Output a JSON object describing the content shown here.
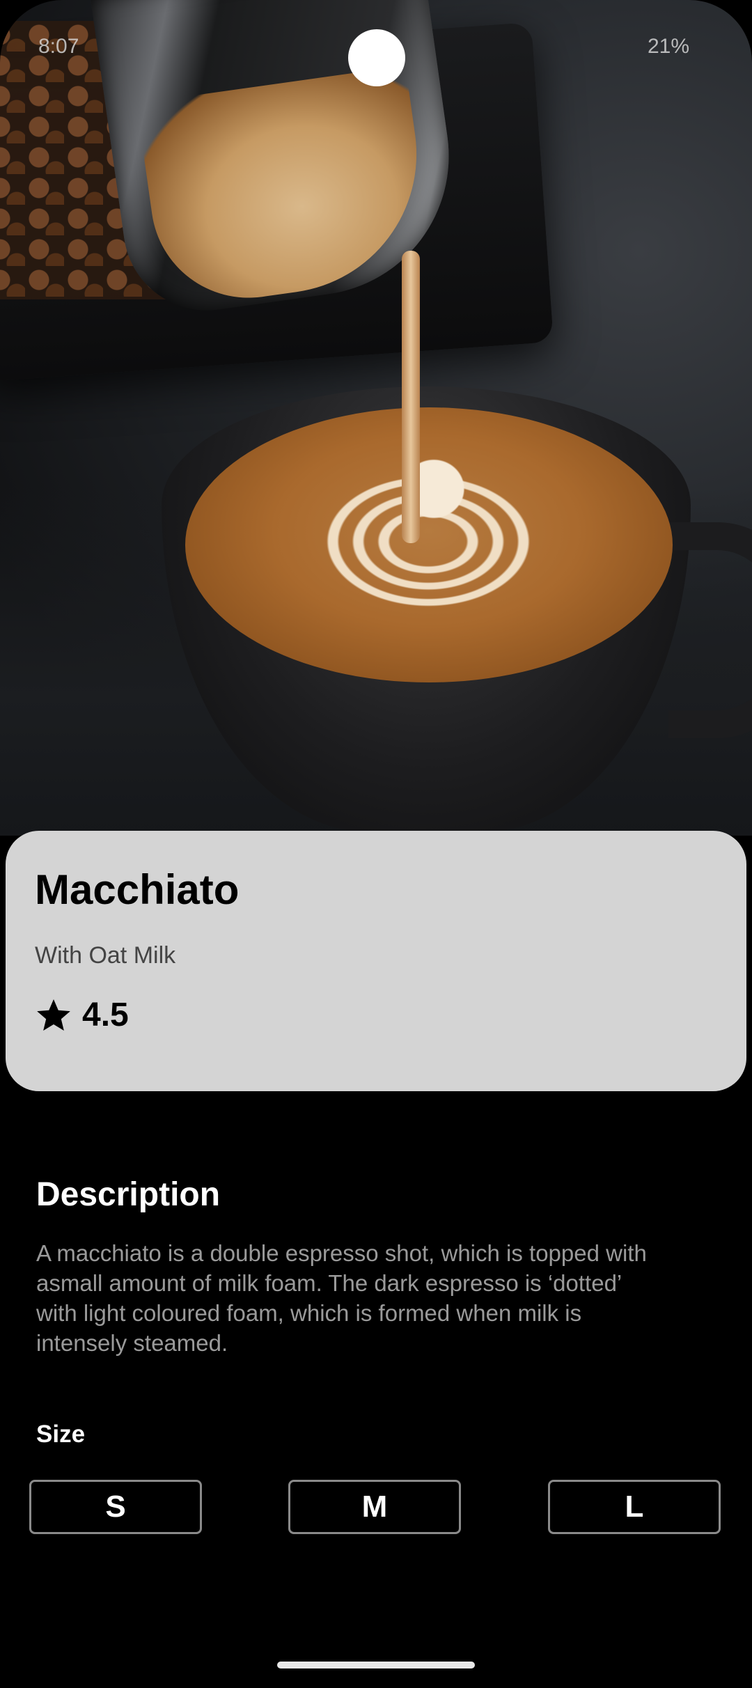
{
  "status_bar": {
    "time": "8:07",
    "right": "21%"
  },
  "product": {
    "name": "Macchiato",
    "subtitle": "With Oat Milk",
    "rating": "4.5"
  },
  "description": {
    "heading": "Description",
    "text": "A macchiato is a double espresso shot, which is topped with\nasmall amount of milk foam. The dark espresso is ‘dotted’\n with light coloured foam, which is formed when milk is\nintensely steamed."
  },
  "size": {
    "heading": "Size",
    "options": [
      "S",
      "M",
      "L"
    ]
  }
}
